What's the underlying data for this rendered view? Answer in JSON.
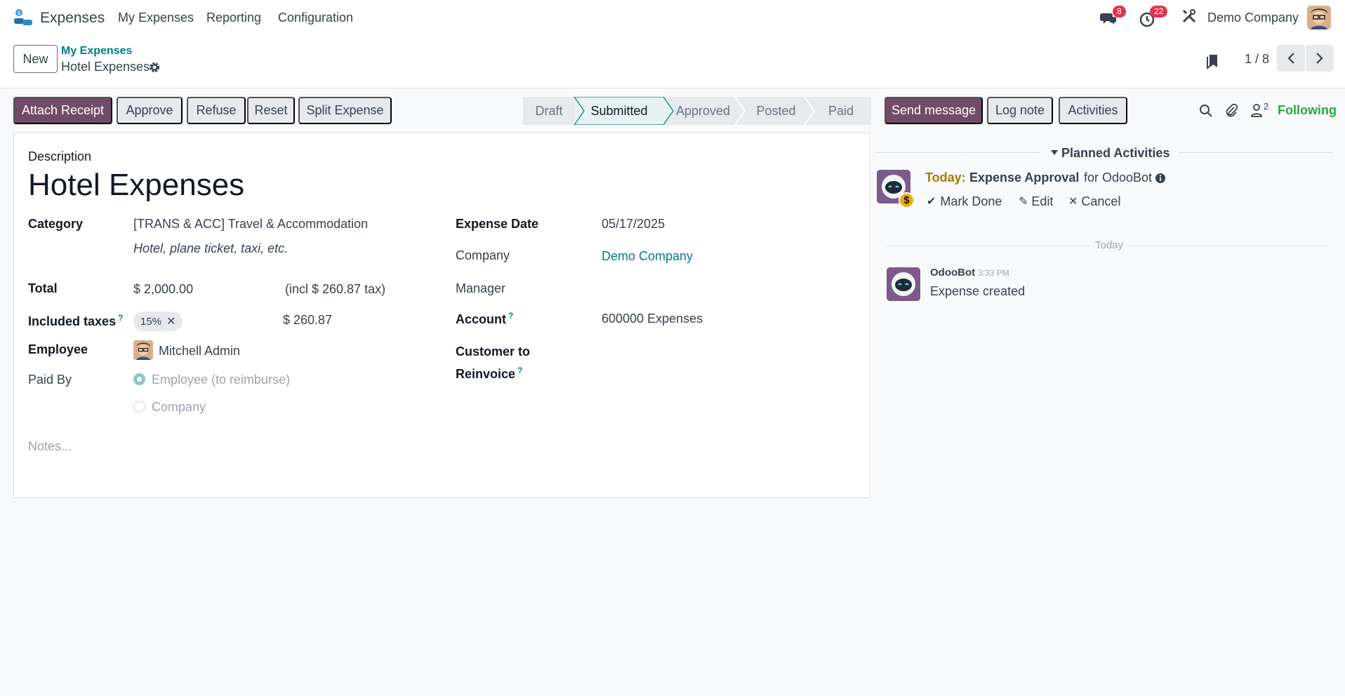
{
  "topbar": {
    "app_name": "Expenses",
    "menu": [
      "My Expenses",
      "Reporting",
      "Configuration"
    ],
    "messages_count": "8",
    "activities_count": "22",
    "company": "Demo Company"
  },
  "control": {
    "new_label": "New",
    "breadcrumb_parent": "My Expenses",
    "breadcrumb_current": "Hotel Expenses",
    "pager": "1 / 8"
  },
  "actions": {
    "attach_receipt": "Attach Receipt",
    "approve": "Approve",
    "refuse": "Refuse",
    "reset": "Reset",
    "split_expense": "Split Expense"
  },
  "status_stages": [
    "Draft",
    "Submitted",
    "Approved",
    "Posted",
    "Paid"
  ],
  "status_active_index": 1,
  "form": {
    "description_label": "Description",
    "title": "Hotel Expenses",
    "category_label": "Category",
    "category_value": "[TRANS & ACC] Travel & Accommodation",
    "category_note": "Hotel, plane ticket, taxi, etc.",
    "total_label": "Total",
    "total_value": "$ 2,000.00",
    "total_tax": "(incl $ 260.87 tax)",
    "taxes_label": "Included taxes",
    "taxes_tag": "15%",
    "taxes_amount": "$ 260.87",
    "employee_label": "Employee",
    "employee_value": "Mitchell Admin",
    "paid_by_label": "Paid By",
    "paid_by_options": [
      "Employee (to reimburse)",
      "Company"
    ],
    "paid_by_selected": 0,
    "expense_date_label": "Expense Date",
    "expense_date_value": "05/17/2025",
    "company_label": "Company",
    "company_value": "Demo Company",
    "manager_label": "Manager",
    "account_label": "Account",
    "account_value": "600000 Expenses",
    "customer_label_1": "Customer to",
    "customer_label_2": "Reinvoice",
    "notes_placeholder": "Notes...",
    "help_mark": "?"
  },
  "chatter": {
    "send_message": "Send message",
    "log_note": "Log note",
    "activities": "Activities",
    "followers_count": "2",
    "following": "Following",
    "planned_title": "Planned Activities",
    "activity": {
      "when": "Today:",
      "name": "Expense Approval",
      "for": "for OdooBot",
      "mark_done": "Mark Done",
      "edit": "Edit",
      "cancel": "Cancel"
    },
    "date_separator": "Today",
    "message": {
      "author": "OdooBot",
      "time": "3:33 PM",
      "body": "Expense created"
    }
  },
  "colors": {
    "primary": "#714b67",
    "link": "#017e84",
    "following": "#28a745",
    "badge": "#e0334a",
    "today": "#a67a00"
  }
}
